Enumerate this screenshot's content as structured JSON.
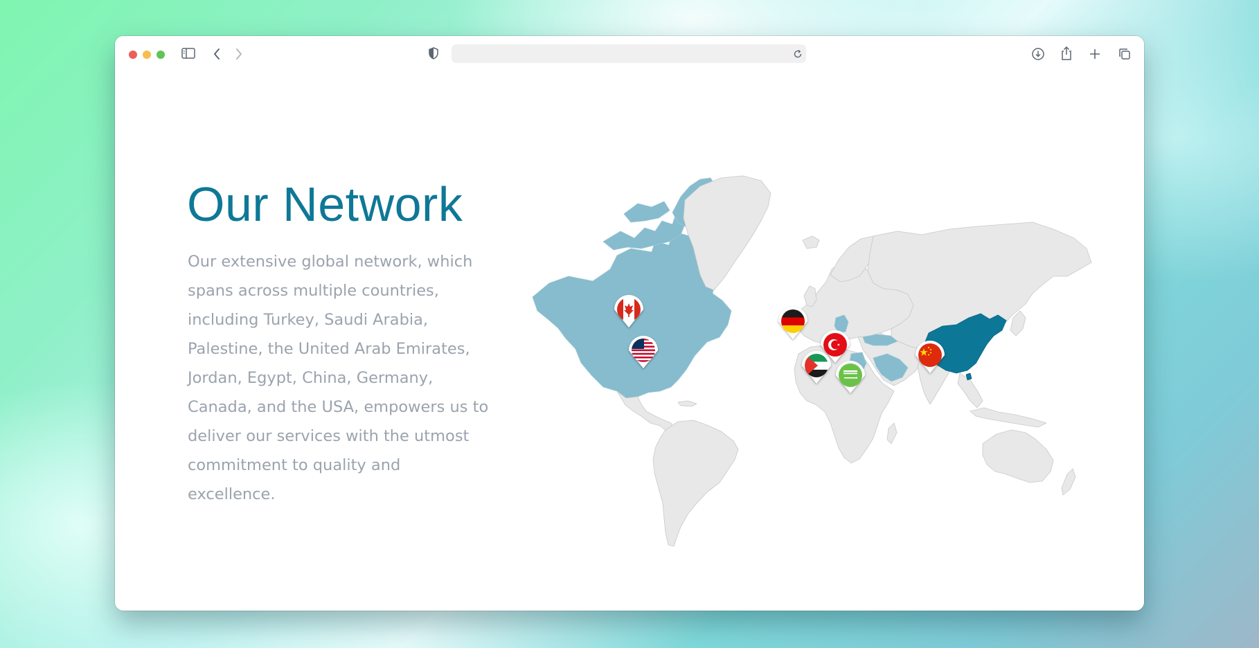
{
  "window": {
    "traffic_lights": {
      "close": "#ec5f57",
      "minimize": "#f5bf4f",
      "zoom": "#61c454"
    },
    "toolbar_icons": [
      "sidebar-icon",
      "back-icon",
      "forward-icon",
      "shield-icon",
      "reload-icon",
      "download-icon",
      "share-icon",
      "new-tab-icon",
      "tabs-overview-icon"
    ],
    "url_value": ""
  },
  "page": {
    "title": "Our Network",
    "description": "Our extensive global network, which spans across multiple countries, including Turkey, Saudi Arabia, Palestine, the United Arab Emirates, Jordan, Egypt, China, Germany, Canada, and the USA, empowers us to deliver our services with the utmost commitment to quality and excellence.",
    "title_color": "#0e7896",
    "text_color": "#9ba3ad"
  },
  "map": {
    "highlight_colors": {
      "primary": "#0d7797",
      "secondary": "#86bccd",
      "land": "#e8e8e8"
    },
    "markers": [
      {
        "country": "Canada",
        "flag": "canada-flag-icon"
      },
      {
        "country": "USA",
        "flag": "usa-flag-icon"
      },
      {
        "country": "Germany",
        "flag": "germany-flag-icon"
      },
      {
        "country": "Turkey",
        "flag": "turkey-flag-icon"
      },
      {
        "country": "Palestine",
        "flag": "palestine-flag-icon"
      },
      {
        "country": "Saudi Arabia",
        "flag": "saudi-flag-icon"
      },
      {
        "country": "China",
        "flag": "china-flag-icon"
      }
    ]
  }
}
